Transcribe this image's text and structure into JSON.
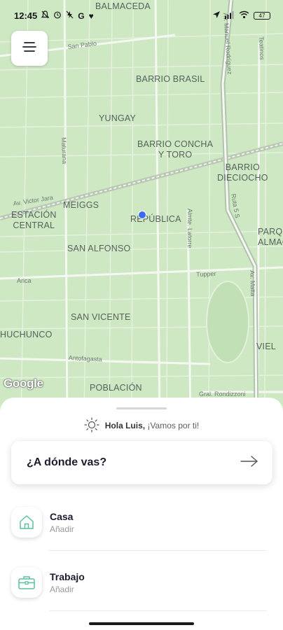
{
  "status_bar": {
    "time": "12:45",
    "left_icons": [
      "muted-bell-icon",
      "alarm-icon",
      "flash-off-icon",
      "google-icon",
      "heart-icon"
    ],
    "right_icons": [
      "location-arrow-icon",
      "signal-icon",
      "wifi-icon"
    ],
    "battery": "47"
  },
  "map": {
    "neighborhoods": [
      "BALMACEDA",
      "BARRIO BRASIL",
      "YUNGAY",
      "BARRIO CONCHA\nY TORO",
      "BARRIO\nDIECIOCHO",
      "MEIGGS",
      "ESTACIÓN\nCENTRAL",
      "REPÚBLICA",
      "SAN ALFONSO",
      "PARQ\nALMAC",
      "SAN VICENTE",
      "HUCHUNCO",
      "POBLACIÓN",
      "VIEL"
    ],
    "streets": [
      "San Pablo",
      "Av. Manuel Rodríguez",
      "Teatinos",
      "Maturana",
      "Av. Victor Jara",
      "Ruta 5 S",
      "Almte. Latorre",
      "Arica",
      "Tupper",
      "Antofagasta",
      "Av. Matta",
      "Gral. Rondizzoni"
    ],
    "attribution": "Google"
  },
  "menu_button": {
    "icon": "menu-icon"
  },
  "sheet": {
    "greeting_name": "Hola Luis,",
    "greeting_rest": " ¡Vamos por ti!",
    "search_label": "¿A dónde vas?",
    "places": [
      {
        "title": "Casa",
        "subtitle": "Añadir",
        "icon": "home-icon"
      },
      {
        "title": "Trabajo",
        "subtitle": "Añadir",
        "icon": "briefcase-icon"
      }
    ],
    "accent_color": "#5bbfa0"
  }
}
